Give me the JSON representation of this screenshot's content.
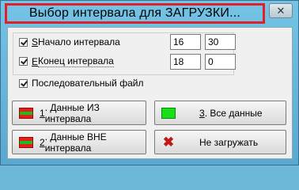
{
  "window": {
    "title": "Выбор интервала для ЗАГРУЗКИ...",
    "close_glyph": "✕"
  },
  "interval": {
    "start": {
      "hotkey": "S",
      "label": " Начало интервала",
      "checked": true,
      "hours": "16",
      "minutes": "30"
    },
    "end": {
      "hotkey": "E",
      "label": " Конец интервала",
      "checked": true,
      "hours": "18",
      "minutes": "0"
    }
  },
  "sequential_file": {
    "label": "Последовательный файл",
    "checked": true
  },
  "buttons": {
    "data_in": {
      "hotkey": "1",
      "label": ". Данные ИЗ интервала",
      "icon": "red-green-stripes-icon"
    },
    "data_out": {
      "hotkey": "2",
      "label": ". Данные ВНЕ интервала",
      "icon": "red-green-stripes-icon"
    },
    "all_data": {
      "hotkey": "3",
      "label": ". Все данные",
      "icon": "green-square-icon"
    },
    "dont_load": {
      "label": "Не загружать",
      "icon": "red-x-icon",
      "glyph": "✖"
    }
  },
  "colors": {
    "title_highlight": "#e0202a",
    "stripe_red": "#e0201f",
    "stripe_green": "#18c018"
  }
}
